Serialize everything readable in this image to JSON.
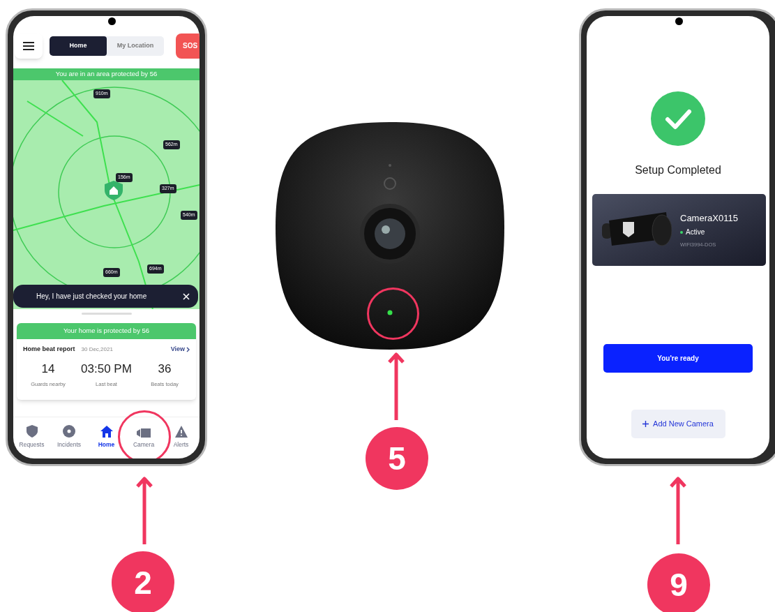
{
  "home_screen": {
    "tabs": [
      {
        "label": "Home",
        "selected": true
      },
      {
        "label": "My Location",
        "selected": false
      }
    ],
    "sos_button": "SOS",
    "area_banner": "You are in an area protected by 56",
    "map_markers": [
      {
        "label": "910m"
      },
      {
        "label": "562m"
      },
      {
        "label": "156m"
      },
      {
        "label": "327m"
      },
      {
        "label": "540m"
      },
      {
        "label": "660m"
      },
      {
        "label": "694m"
      }
    ],
    "toast": "Hey, I have just checked your home",
    "protection_banner": "Your home is protected by 56",
    "beat_report": {
      "title": "Home beat report",
      "date": "30 Dec,2021",
      "link": "View"
    },
    "stats": [
      {
        "value": "14",
        "label": "Guards nearby"
      },
      {
        "value": "03:50 PM",
        "label": "Last beat"
      },
      {
        "value": "36",
        "label": "Beats today"
      }
    ],
    "nav": [
      {
        "label": "Requests",
        "selected": false,
        "highlighted": false
      },
      {
        "label": "Incidents",
        "selected": false,
        "highlighted": false
      },
      {
        "label": "Home",
        "selected": true,
        "highlighted": false
      },
      {
        "label": "Camera",
        "selected": false,
        "highlighted": true
      },
      {
        "label": "Alerts",
        "selected": false,
        "highlighted": false
      }
    ]
  },
  "steps": [
    {
      "number": "2"
    },
    {
      "number": "5"
    },
    {
      "number": "9"
    }
  ],
  "setup_screen": {
    "title": "Setup Completed",
    "camera": {
      "name": "CameraX0115",
      "status": "Active",
      "network": "WIFI3994-DOS"
    },
    "primary_button": "You're ready",
    "add_button": "Add New Camera"
  }
}
